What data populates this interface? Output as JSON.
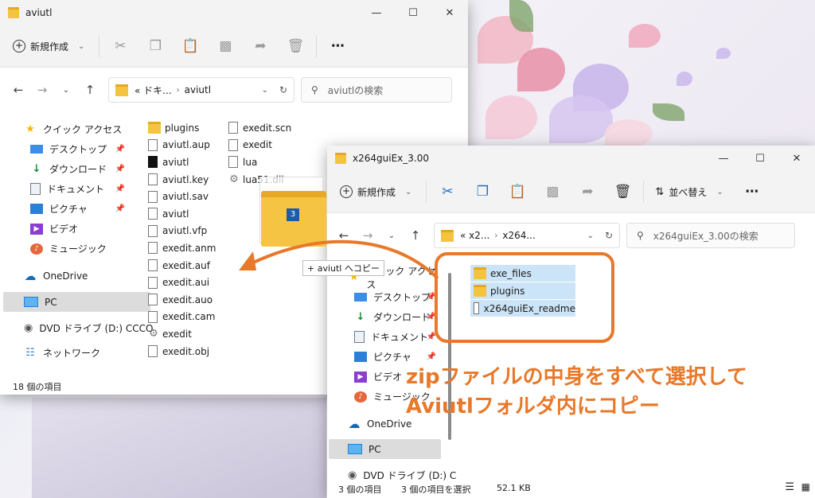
{
  "window1": {
    "title": "aviutl",
    "new_label": "新規作成",
    "breadcrumb": [
      "« ドキ...",
      "aviutl"
    ],
    "search_placeholder": "aviutlの検索",
    "status": "18 個の項目",
    "nav": [
      {
        "label": "クイック アクセス",
        "icon": "star-icon"
      },
      {
        "label": "デスクトップ",
        "icon": "desktop-icon",
        "pinned": true
      },
      {
        "label": "ダウンロード",
        "icon": "download-icon",
        "pinned": true
      },
      {
        "label": "ドキュメント",
        "icon": "document-icon",
        "pinned": true
      },
      {
        "label": "ピクチャ",
        "icon": "picture-icon",
        "pinned": true
      },
      {
        "label": "ビデオ",
        "icon": "video-icon"
      },
      {
        "label": "ミュージック",
        "icon": "music-icon"
      },
      {
        "label": "OneDrive",
        "icon": "cloud-icon"
      },
      {
        "label": "PC",
        "icon": "pc-icon"
      },
      {
        "label": "DVD ドライブ (D:) CCCO",
        "icon": "dvd-icon"
      },
      {
        "label": "ネットワーク",
        "icon": "network-icon"
      }
    ],
    "files_col1": [
      "plugins",
      "aviutl.aup",
      "aviutl",
      "aviutl.key",
      "aviutl.sav",
      "aviutl",
      "aviutl.vfp",
      "exedit.anm",
      "exedit.auf",
      "exedit.aui",
      "exedit.auo",
      "exedit.cam",
      "exedit",
      "exedit.obj"
    ],
    "files_col2": [
      "exedit.scn",
      "exedit",
      "lua",
      "lua51.dll"
    ],
    "drag_count": "3",
    "drag_tooltip": "+ aviutl へコピー"
  },
  "window2": {
    "title": "x264guiEx_3.00",
    "new_label": "新規作成",
    "sort_label": "並べ替え",
    "breadcrumb": [
      "« x2...",
      "x264..."
    ],
    "search_placeholder": "x264guiEx_3.00の検索",
    "status_count": "3 個の項目",
    "status_selected": "3 個の項目を選択",
    "status_size": "52.1 KB",
    "nav": [
      {
        "label": "クイック アクセス",
        "icon": "star-icon"
      },
      {
        "label": "デスクトップ",
        "icon": "desktop-icon",
        "pinned": true
      },
      {
        "label": "ダウンロード",
        "icon": "download-icon",
        "pinned": true
      },
      {
        "label": "ドキュメント",
        "icon": "document-icon",
        "pinned": true
      },
      {
        "label": "ピクチャ",
        "icon": "picture-icon",
        "pinned": true
      },
      {
        "label": "ビデオ",
        "icon": "video-icon"
      },
      {
        "label": "ミュージック",
        "icon": "music-icon"
      },
      {
        "label": "OneDrive",
        "icon": "cloud-icon"
      },
      {
        "label": "PC",
        "icon": "pc-icon"
      },
      {
        "label": "DVD ドライブ (D:) C",
        "icon": "dvd-icon"
      }
    ],
    "files": [
      "exe_files",
      "plugins",
      "x264guiEx_readme"
    ]
  },
  "annotation": {
    "line1": "zipファイルの中身をすべて選択して",
    "line2": "Aviutlフォルダ内にコピー",
    "color": "#e8782a"
  }
}
